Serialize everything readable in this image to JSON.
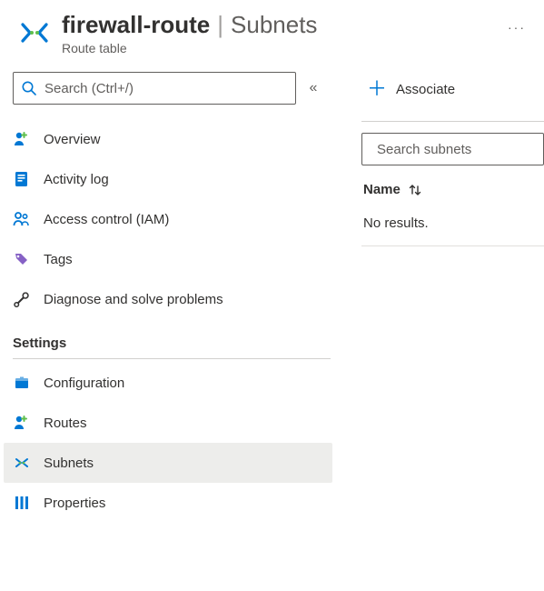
{
  "header": {
    "resource_name": "firewall-route",
    "separator": "|",
    "blade_name": "Subnets",
    "resource_type": "Route table",
    "more_label": "···"
  },
  "sidebar": {
    "search_placeholder": "Search (Ctrl+/)",
    "collapse_glyph": "«",
    "items": [
      {
        "label": "Overview"
      },
      {
        "label": "Activity log"
      },
      {
        "label": "Access control (IAM)"
      },
      {
        "label": "Tags"
      },
      {
        "label": "Diagnose and solve problems"
      }
    ],
    "section_label": "Settings",
    "settings_items": [
      {
        "label": "Configuration"
      },
      {
        "label": "Routes"
      },
      {
        "label": "Subnets"
      },
      {
        "label": "Properties"
      }
    ]
  },
  "main": {
    "associate_label": "Associate",
    "subnet_search_placeholder": "Search subnets",
    "column_name": "Name",
    "no_results": "No results."
  },
  "colors": {
    "accent": "#0078d4",
    "purple": "#8661c5",
    "grey": "#605e5c"
  }
}
